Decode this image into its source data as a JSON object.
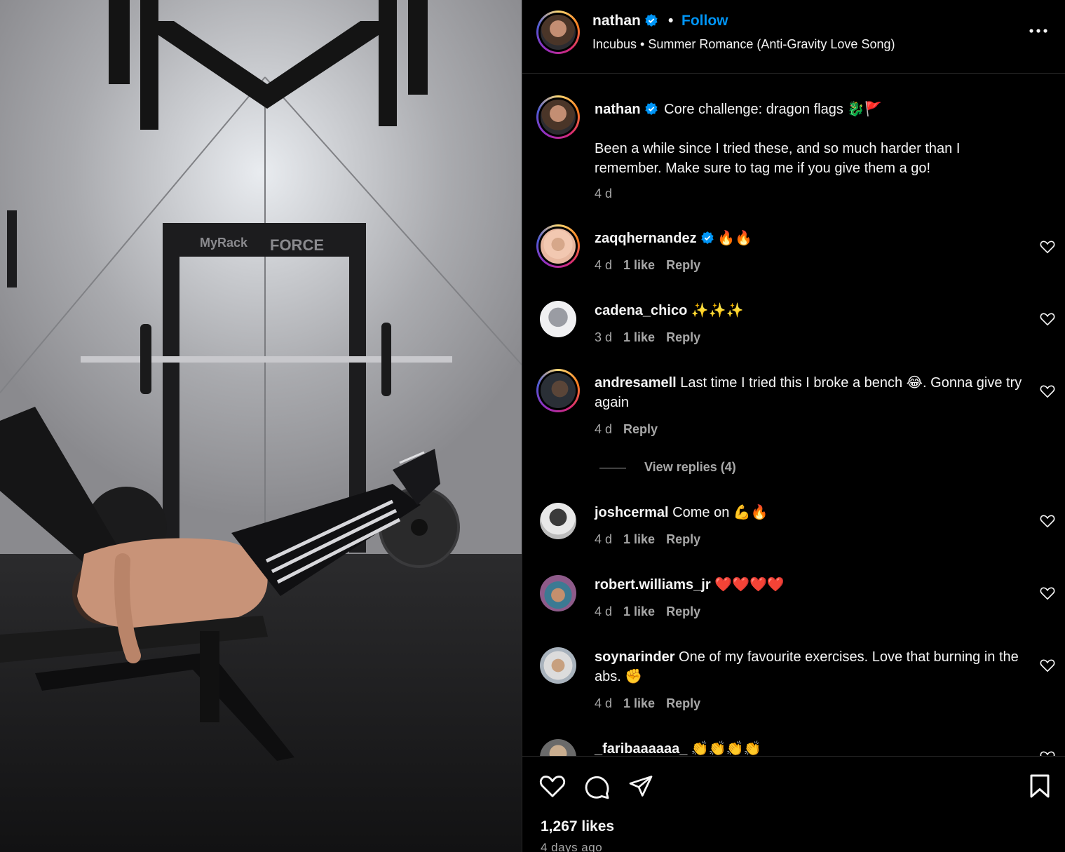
{
  "post": {
    "author": "nathan",
    "follow_label": "Follow",
    "separator": "•",
    "audio": "Incubus • Summer Romance (Anti-Gravity Love Song)",
    "caption_user": "nathan",
    "caption_title": "Core challenge: dragon flags 🐉🚩",
    "caption_body": "Been a while since I tried these, and so much harder than I remember. Make sure to tag me if you give them a go!",
    "caption_time": "4 d",
    "media_text": {
      "logo_line1": "MyRack",
      "logo_line2": "FORCE"
    }
  },
  "comments": [
    {
      "user": "zaqqhernandez",
      "verified": true,
      "text": " 🔥🔥",
      "time": "4 d",
      "likes": "1 like",
      "reply": "Reply"
    },
    {
      "user": "cadena_chico",
      "verified": false,
      "text": " ✨✨✨",
      "time": "3 d",
      "likes": "1 like",
      "reply": "Reply"
    },
    {
      "user": "andresamell",
      "verified": false,
      "text": " Last time I tried this I broke a bench 😂. Gonna give try again",
      "time": "4 d",
      "likes": "",
      "reply": "Reply"
    },
    {
      "user": "joshcermal",
      "verified": false,
      "text": " Come on 💪🔥",
      "time": "4 d",
      "likes": "1 like",
      "reply": "Reply"
    },
    {
      "user": "robert.williams_jr",
      "verified": false,
      "text": " ❤️❤️❤️❤️",
      "time": "4 d",
      "likes": "1 like",
      "reply": "Reply"
    },
    {
      "user": "soynarinder",
      "verified": false,
      "text": " One of my favourite exercises. Love that burning in the abs. ✊",
      "time": "4 d",
      "likes": "1 like",
      "reply": "Reply"
    },
    {
      "user": "_faribaaaaaa_",
      "verified": false,
      "text": " 👏👏👏👏",
      "time": "",
      "likes": "",
      "reply": ""
    }
  ],
  "view_replies": "View replies (4)",
  "footer": {
    "likes": "1,267 likes",
    "date": "4 days ago"
  },
  "icons": {
    "verified": "verified-badge-icon",
    "more": "more-options-icon",
    "like": "heart-icon",
    "comment": "comment-icon",
    "share": "share-icon",
    "save": "bookmark-icon"
  },
  "colors": {
    "accent": "#0095f6",
    "text": "#f5f5f5",
    "muted": "#a8a8a8",
    "divider": "#262626"
  }
}
